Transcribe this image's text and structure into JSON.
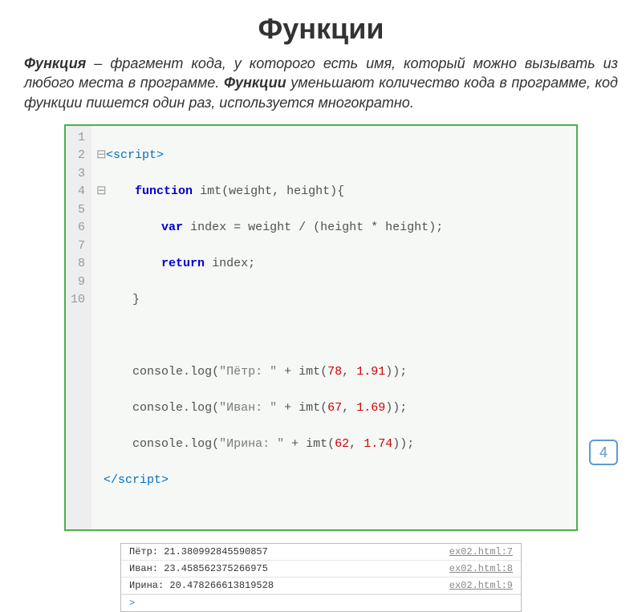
{
  "title": "Функции",
  "description": {
    "term": "Функция",
    "dash": " – ",
    "part1": "фрагмент кода, у которого есть имя, который можно вызывать из любого места в программе.  ",
    "term2": "Функции",
    "part2": " уменьшают количество кода в программе, код функции пишется один раз, используется многократно."
  },
  "code": {
    "lines": [
      "1",
      "2",
      "3",
      "4",
      "5",
      "6",
      "7",
      "8",
      "9",
      "10"
    ],
    "tokens": {
      "script_open": "<script>",
      "script_close": "</",
      "script_close2": "script>",
      "fold1": "⊟",
      "fold2": "⊟",
      "kw_function": "function",
      "fn_name": "imt",
      "param_w": "weight",
      "param_h": "height",
      "kw_var": "var",
      "var_index": "index",
      "eq": " = ",
      "div": " / ",
      "mul": " * ",
      "kw_return": "return",
      "console": "console",
      "log": "log",
      "str1": "\"Пётр: \"",
      "str2": "\"Иван: \"",
      "str3": "\"Ирина: \"",
      "plus": " + ",
      "n1a": "78",
      "n1b": "1.91",
      "n2a": "67",
      "n2b": "1.69",
      "n3a": "62",
      "n3b": "1.74",
      "lbrace": "{",
      "rbrace": "}",
      "lparen": "(",
      "rparen": ")",
      "comma": ", ",
      "semi": ";"
    }
  },
  "console": {
    "rows": [
      {
        "text": "Пётр: 21.380992845590857",
        "src": "ex02.html:7"
      },
      {
        "text": "Иван: 23.458562375266975",
        "src": "ex02.html:8"
      },
      {
        "text": "Ирина: 20.478266613819528",
        "src": "ex02.html:9"
      }
    ],
    "prompt": ">"
  },
  "page_number": "4"
}
